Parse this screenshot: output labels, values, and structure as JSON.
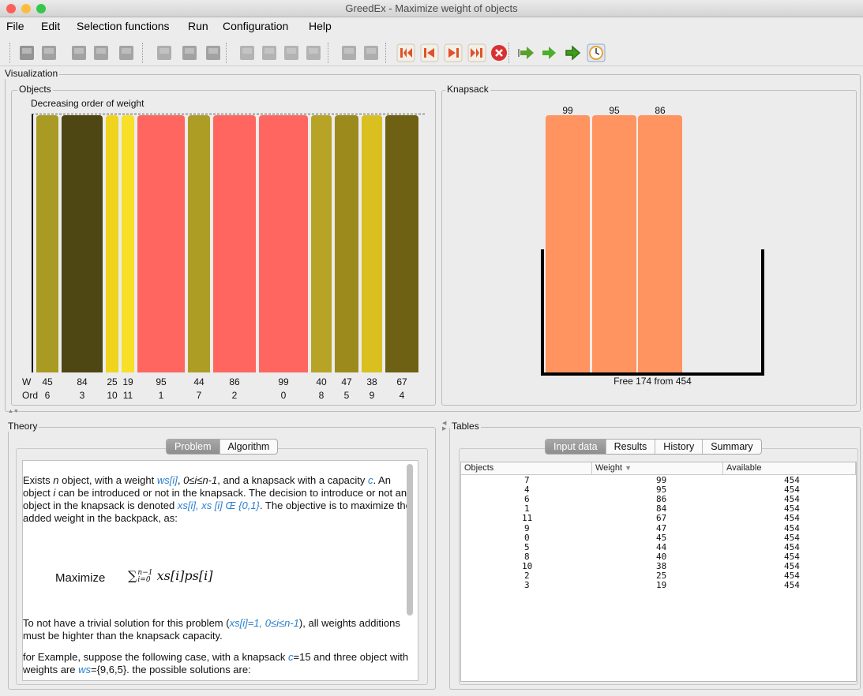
{
  "window": {
    "title": "GreedEx - Maximize weight of objects",
    "traffic_lights": [
      "#fc605b",
      "#fdbc40",
      "#34c84a"
    ]
  },
  "menu": [
    "File",
    "Edit",
    "Selection functions",
    "Run",
    "Configuration",
    "Help"
  ],
  "toolbar": {
    "buttons": [
      {
        "name": "new-icon",
        "color": "#777"
      },
      {
        "name": "open-gear-icon",
        "color": "#888"
      },
      {
        "name": "open-folder-icon",
        "color": "#8a8a8a"
      },
      {
        "name": "save-icon",
        "color": "#8c8c8c"
      },
      {
        "name": "save-as-icon",
        "color": "#8c8c8c"
      },
      {
        "name": "edit-icon",
        "color": "#9a9a9a"
      },
      {
        "name": "copy-icon",
        "color": "#8a8a8a"
      },
      {
        "name": "delete-icon",
        "color": "#8a8a8a"
      },
      {
        "name": "table-icon-1",
        "color": "#a0a0a0"
      },
      {
        "name": "table-icon-2",
        "color": "#a0a0a0"
      },
      {
        "name": "table-icon-3",
        "color": "#a0a0a0"
      },
      {
        "name": "table-icon-4",
        "color": "#a0a0a0"
      },
      {
        "name": "users-icon-1",
        "color": "#9a9a9a"
      },
      {
        "name": "users-icon-2",
        "color": "#9a9a9a"
      },
      {
        "name": "first-step-icon",
        "color": "#e0522a"
      },
      {
        "name": "previous-step-icon",
        "color": "#e0522a"
      },
      {
        "name": "next-step-icon",
        "color": "#e0522a"
      },
      {
        "name": "last-step-icon",
        "color": "#e0522a"
      },
      {
        "name": "stop-icon",
        "color": "#d93030"
      },
      {
        "name": "run-fast-icon",
        "color": "#5aa02c"
      },
      {
        "name": "run-icon",
        "color": "#4caf2a"
      },
      {
        "name": "run-step-icon",
        "color": "#3e9d1c"
      },
      {
        "name": "timer-icon",
        "color": "#e8a23a"
      }
    ]
  },
  "visualization": {
    "title": "Visualization",
    "objects": {
      "title": "Objects",
      "order_label": "Decreasing order of weight",
      "w_label": "W",
      "ord_label": "Ord",
      "items": [
        {
          "w": "45",
          "ord": "6",
          "color": "#a89a22"
        },
        {
          "w": "84",
          "ord": "3",
          "color": "#4e4613"
        },
        {
          "w": "25",
          "ord": "10",
          "color": "#f0d31c"
        },
        {
          "w": "19",
          "ord": "11",
          "color": "#f7e027"
        },
        {
          "w": "95",
          "ord": "1",
          "color": "#ff6660"
        },
        {
          "w": "44",
          "ord": "7",
          "color": "#ae9d24"
        },
        {
          "w": "86",
          "ord": "2",
          "color": "#ff6660"
        },
        {
          "w": "99",
          "ord": "0",
          "color": "#ff6660"
        },
        {
          "w": "40",
          "ord": "8",
          "color": "#b7a325"
        },
        {
          "w": "47",
          "ord": "5",
          "color": "#9c8b1c"
        },
        {
          "w": "38",
          "ord": "9",
          "color": "#d9bf20"
        },
        {
          "w": "67",
          "ord": "4",
          "color": "#6e6114"
        }
      ]
    },
    "knapsack": {
      "title": "Knapsack",
      "items": [
        "99",
        "95",
        "86"
      ],
      "free_text": "Free 174 from 454"
    }
  },
  "theory": {
    "title": "Theory",
    "tabs": [
      "Problem",
      "Algorithm"
    ],
    "active_tab": "Problem",
    "p1": {
      "a": "Exists ",
      "n": "n",
      "b": " object, with a weight ",
      "ws": "ws[i]",
      "c": ", ",
      "range": "0≤i≤n-1",
      "d": ", and a knapsack with a capacity ",
      "cap": "c",
      "e": ". An object ",
      "i": "i",
      "f": " can be introduced or not in the knapsack. The decision to introduce or not an object in the knapsack is denoted ",
      "xs": "xs[i], xs [i] Œ {0,1}",
      "g": ". The objective is to maximize the added weight in the backpack, as:"
    },
    "formula": {
      "label": "Maximize",
      "expr": "∑",
      "sup": "n−1",
      "sub": "i=0",
      "body": " xs[i]ps[i]"
    },
    "p2": {
      "a": "To not have a trivial solution for this problem (",
      "hl": "xs[i]=1, 0≤i≤n-1",
      "b": "), all weights additions must be highter than the knapsack capacity."
    },
    "p3": {
      "a": "for Example, suppose the following case, with a knapsack ",
      "c": "c",
      "b": "=15 and three object with weights are ",
      "ws": "ws",
      "d": "={9,6,5}. the possible solutions are:"
    }
  },
  "tables": {
    "title": "Tables",
    "tabs": [
      "Input data",
      "Results",
      "History",
      "Summary"
    ],
    "active_tab": "Input data",
    "columns": [
      "Objects",
      "Weight",
      "Available"
    ],
    "sort_indicator": "▼",
    "rows": [
      [
        "7",
        "99",
        "454"
      ],
      [
        "4",
        "95",
        "454"
      ],
      [
        "6",
        "86",
        "454"
      ],
      [
        "1",
        "84",
        "454"
      ],
      [
        "11",
        "67",
        "454"
      ],
      [
        "9",
        "47",
        "454"
      ],
      [
        "0",
        "45",
        "454"
      ],
      [
        "5",
        "44",
        "454"
      ],
      [
        "8",
        "40",
        "454"
      ],
      [
        "10",
        "38",
        "454"
      ],
      [
        "2",
        "25",
        "454"
      ],
      [
        "3",
        "19",
        "454"
      ]
    ]
  }
}
